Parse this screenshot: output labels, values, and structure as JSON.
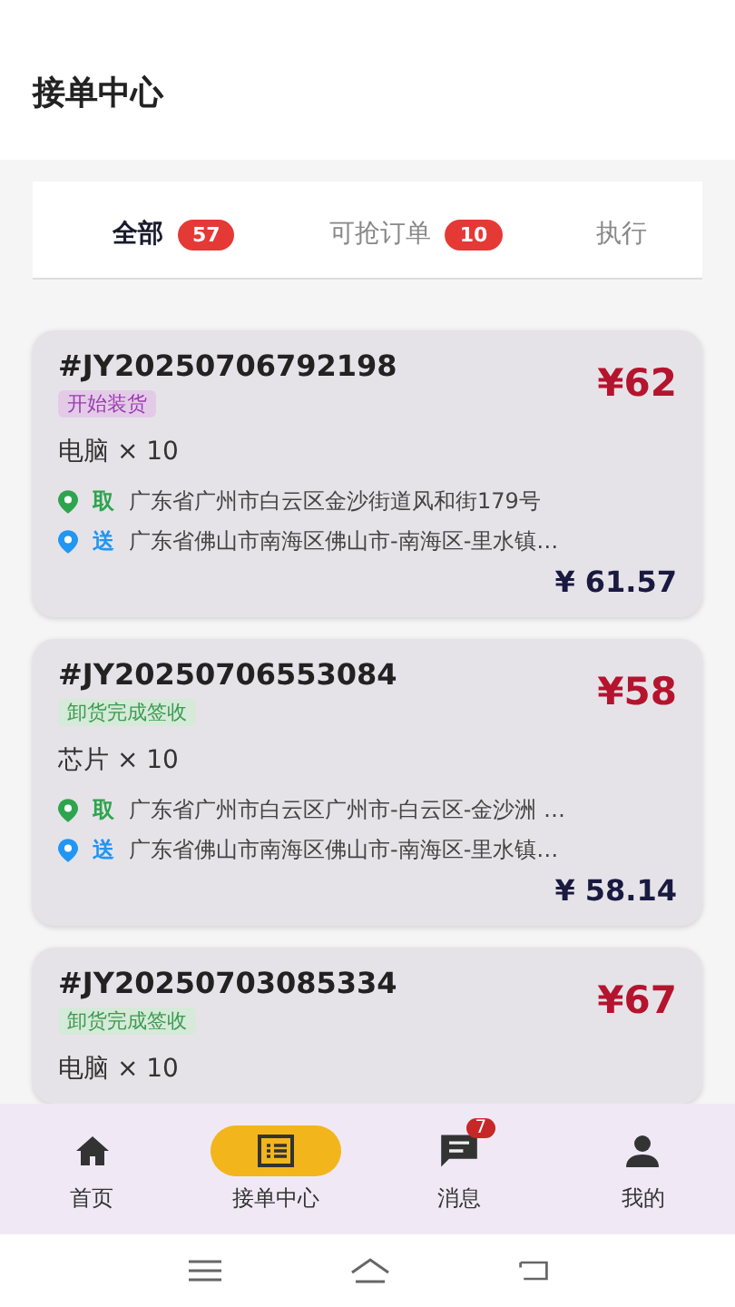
{
  "header": {
    "title": "接单中心"
  },
  "tabs": [
    {
      "label": "全部",
      "count": "57",
      "selected": true
    },
    {
      "label": "可抢订单",
      "count": "10",
      "selected": false
    },
    {
      "label": "执行",
      "selected": false
    }
  ],
  "orders": [
    {
      "number": "#JY20250706792198",
      "status": "开始装货",
      "kind": "loading",
      "price": "¥62",
      "goods": "电脑 × 10",
      "stops": [
        {
          "kind": "pickup",
          "tag": "取",
          "address": "广东省广州市白云区金沙街道风和街179号"
        },
        {
          "kind": "dropoff",
          "tag": "送",
          "address": "广东省佛山市南海区佛山市-南海区-里水镇…"
        }
      ],
      "amount": "¥ 61.57"
    },
    {
      "number": "#JY20250706553084",
      "status": "卸货完成签收",
      "kind": "done",
      "price": "¥58",
      "goods": "芯片 × 10",
      "stops": [
        {
          "kind": "pickup",
          "tag": "取",
          "address": "广东省广州市白云区广州市-白云区-金沙洲 …"
        },
        {
          "kind": "dropoff",
          "tag": "送",
          "address": "广东省佛山市南海区佛山市-南海区-里水镇…"
        }
      ],
      "amount": "¥ 58.14"
    },
    {
      "number": "#JY20250703085334",
      "status": "卸货完成签收",
      "kind": "done",
      "price": "¥67",
      "goods": "电脑 × 10"
    }
  ],
  "nav": [
    {
      "kind": "home",
      "label": "首页",
      "selected": false
    },
    {
      "kind": "orders",
      "label": "接单中心",
      "selected": true
    },
    {
      "kind": "messages",
      "label": "消息",
      "badge": "7",
      "selected": false
    },
    {
      "kind": "profile",
      "label": "我的",
      "selected": false
    }
  ]
}
